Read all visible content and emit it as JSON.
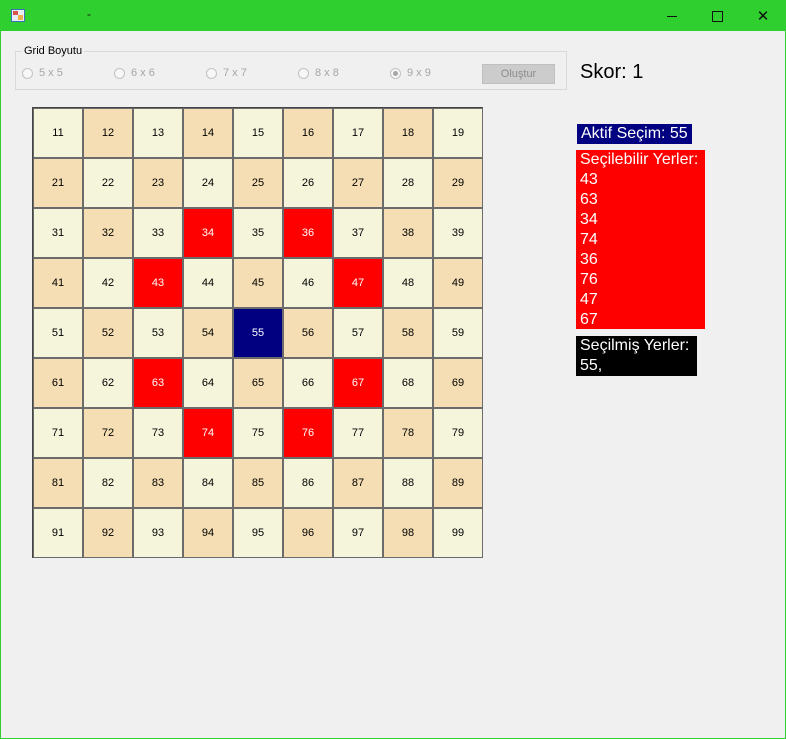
{
  "window": {
    "title": "-",
    "titlebar_color": "#2ecf2e"
  },
  "grid_size_group": {
    "legend": "Grid Boyutu",
    "options": [
      "5 x 5",
      "6 x 6",
      "7 x 7",
      "8 x 8",
      "9 x 9"
    ],
    "selected": "9 x 9",
    "create_label": "Oluştur"
  },
  "score": {
    "label": "Skor: 1"
  },
  "board": {
    "cells": [
      [
        "11",
        "12",
        "13",
        "14",
        "15",
        "16",
        "17",
        "18",
        "19"
      ],
      [
        "21",
        "22",
        "23",
        "24",
        "25",
        "26",
        "27",
        "28",
        "29"
      ],
      [
        "31",
        "32",
        "33",
        "34",
        "35",
        "36",
        "37",
        "38",
        "39"
      ],
      [
        "41",
        "42",
        "43",
        "44",
        "45",
        "46",
        "47",
        "48",
        "49"
      ],
      [
        "51",
        "52",
        "53",
        "54",
        "55",
        "56",
        "57",
        "58",
        "59"
      ],
      [
        "61",
        "62",
        "63",
        "64",
        "65",
        "66",
        "67",
        "68",
        "69"
      ],
      [
        "71",
        "72",
        "73",
        "74",
        "75",
        "76",
        "77",
        "78",
        "79"
      ],
      [
        "81",
        "82",
        "83",
        "84",
        "85",
        "86",
        "87",
        "88",
        "89"
      ],
      [
        "91",
        "92",
        "93",
        "94",
        "95",
        "96",
        "97",
        "98",
        "99"
      ]
    ],
    "active_cell": "55",
    "selectable_cells": [
      "43",
      "63",
      "34",
      "74",
      "36",
      "76",
      "47",
      "67"
    ],
    "colors": {
      "light": "#f5f5dc",
      "dark": "#f5deb3",
      "selectable": "#ff0000",
      "active": "#000080"
    }
  },
  "info": {
    "active_label": "Aktif Seçim: 55",
    "selectable_title": "Seçilebilir Yerler:",
    "selectable_list": [
      "43",
      "63",
      "34",
      "74",
      "36",
      "76",
      "47",
      "67"
    ],
    "selected_title": "Seçilmiş Yerler:",
    "selected_value": "55,"
  }
}
